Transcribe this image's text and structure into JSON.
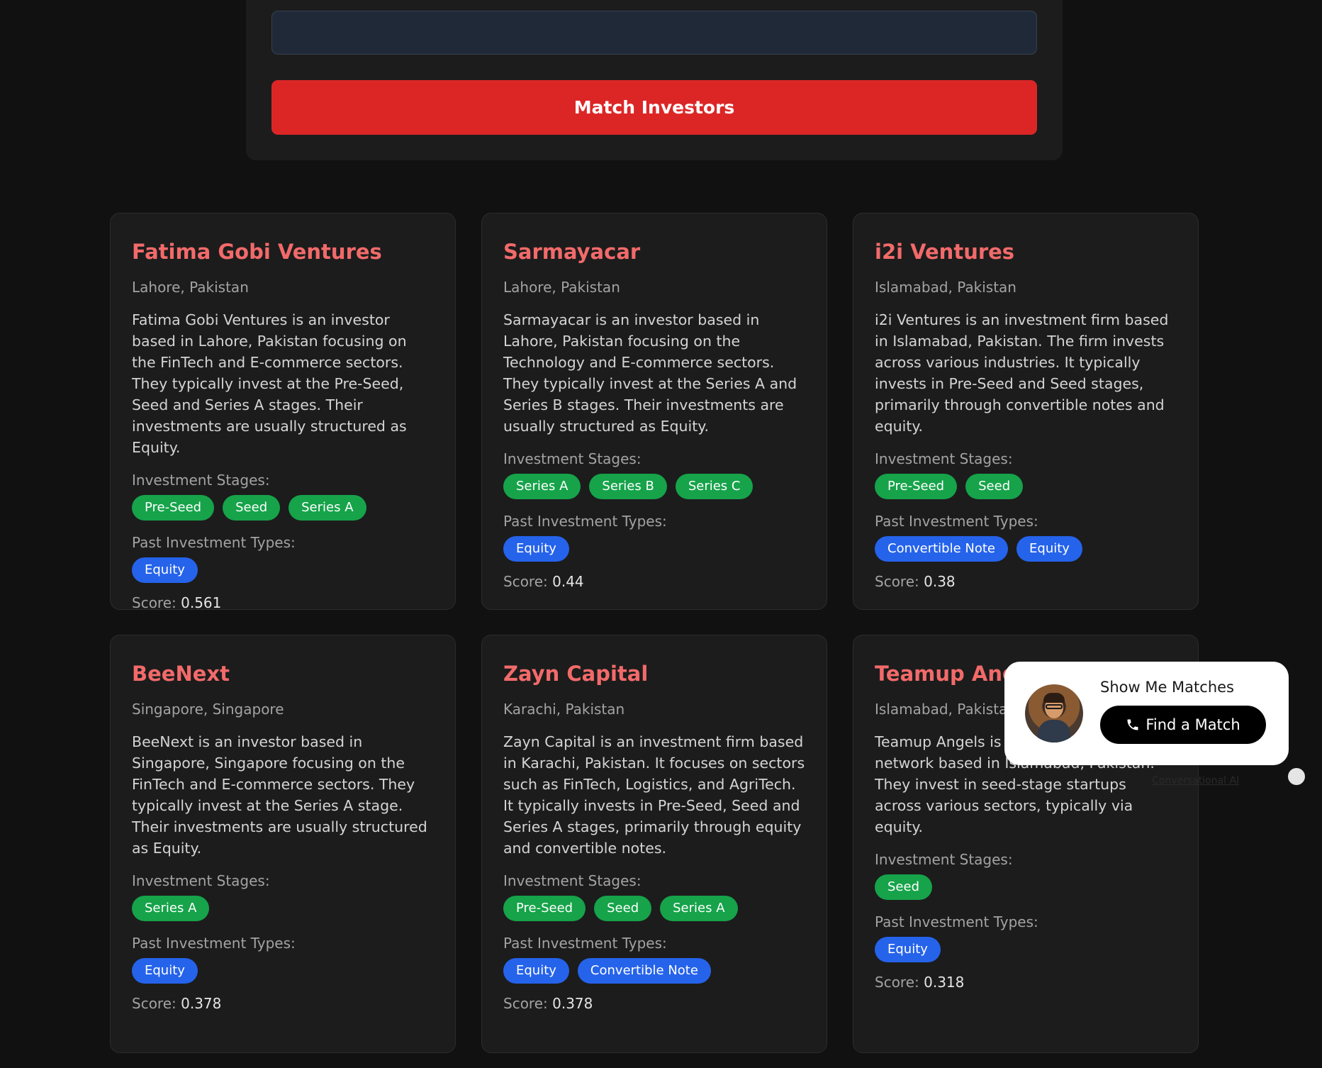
{
  "form": {
    "input_value": "",
    "match_button_label": "Match Investors"
  },
  "labels": {
    "stages": "Investment Stages:",
    "types": "Past Investment Types:",
    "score": "Score:"
  },
  "investors": [
    {
      "name": "Fatima Gobi Ventures",
      "location": "Lahore, Pakistan",
      "description": "Fatima Gobi Ventures is an investor based in Lahore, Pakistan focusing on the FinTech and E-commerce sectors. They typically invest at the Pre-Seed, Seed and Series A stages. Their investments are usually structured as Equity.",
      "stages": [
        "Pre-Seed",
        "Seed",
        "Series A"
      ],
      "types": [
        "Equity"
      ],
      "score": "0.561"
    },
    {
      "name": "Sarmayacar",
      "location": "Lahore, Pakistan",
      "description": "Sarmayacar is an investor based in Lahore, Pakistan focusing on the Technology and E-commerce sectors. They typically invest at the Series A and Series B stages. Their investments are usually structured as Equity.",
      "stages": [
        "Series A",
        "Series B",
        "Series C"
      ],
      "types": [
        "Equity"
      ],
      "score": "0.44"
    },
    {
      "name": "i2i Ventures",
      "location": "Islamabad, Pakistan",
      "description": "i2i Ventures is an investment firm based in Islamabad, Pakistan. The firm invests across various industries. It typically invests in Pre-Seed and Seed stages, primarily through convertible notes and equity.",
      "stages": [
        "Pre-Seed",
        "Seed"
      ],
      "types": [
        "Convertible Note",
        "Equity"
      ],
      "score": "0.38"
    },
    {
      "name": "BeeNext",
      "location": "Singapore, Singapore",
      "description": "BeeNext is an investor based in Singapore, Singapore focusing on the FinTech and E-commerce sectors. They typically invest at the Series A stage. Their investments are usually structured as Equity.",
      "stages": [
        "Series A"
      ],
      "types": [
        "Equity"
      ],
      "score": "0.378"
    },
    {
      "name": "Zayn Capital",
      "location": "Karachi, Pakistan",
      "description": "Zayn Capital is an investment firm based in Karachi, Pakistan. It focuses on sectors such as FinTech, Logistics, and AgriTech. It typically invests in Pre-Seed, Seed and Series A stages, primarily through equity and convertible notes.",
      "stages": [
        "Pre-Seed",
        "Seed",
        "Series A"
      ],
      "types": [
        "Equity",
        "Convertible Note"
      ],
      "score": "0.378"
    },
    {
      "name": "Teamup Angels",
      "location": "Islamabad, Pakistan",
      "description": "Teamup Angels is an angel investor network based in Islamabad, Pakistan. They invest in seed-stage startups across various sectors, typically via equity.",
      "stages": [
        "Seed"
      ],
      "types": [
        "Equity"
      ],
      "score": "0.318"
    }
  ],
  "widget": {
    "title": "Show Me Matches",
    "button_label": "Find a Match",
    "powered_by": "Conversational AI",
    "icon": "phone-icon",
    "avatar": "avatar"
  },
  "colors": {
    "accent_red": "#dc2626",
    "title_red": "#f26a6a",
    "stage_green": "#16a34a",
    "type_blue": "#2563eb"
  }
}
